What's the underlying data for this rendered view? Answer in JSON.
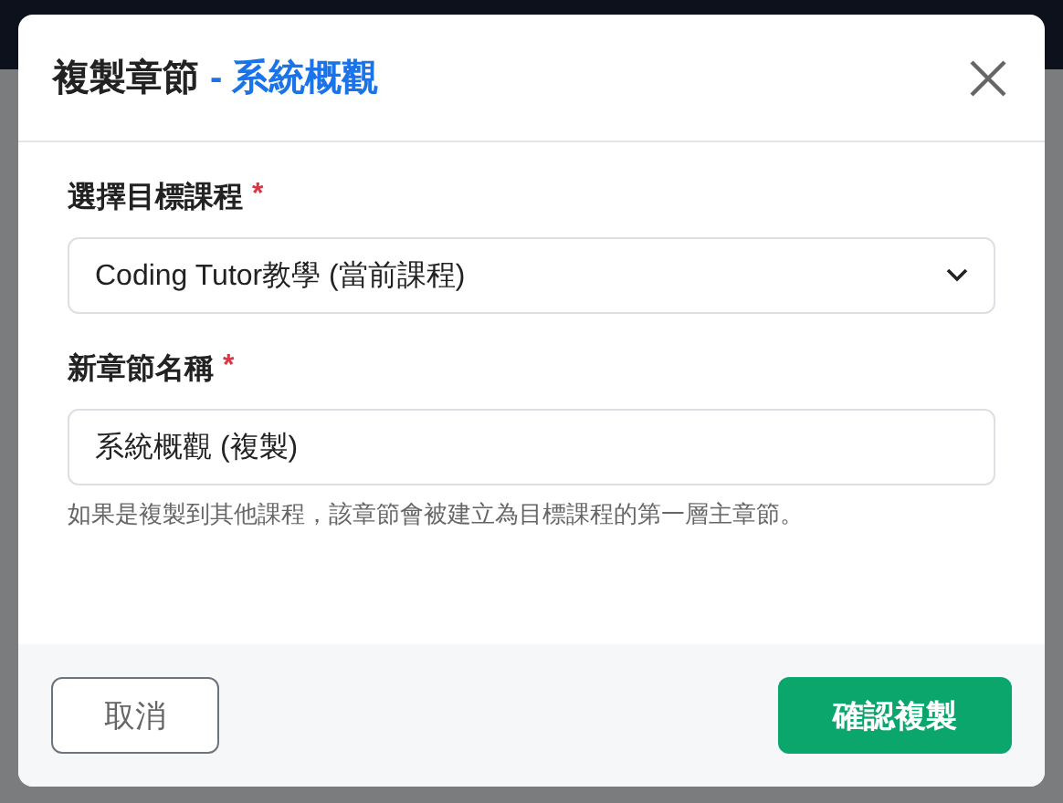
{
  "dialog": {
    "title": "複製章節",
    "title_separator": "-",
    "chapter_name": "系統概觀",
    "fields": [
      {
        "kind": "select",
        "label": "選擇目標課程",
        "required_mark": "*",
        "value": "Coding Tutor教學 (當前課程)"
      },
      {
        "kind": "text",
        "label": "新章節名稱",
        "required_mark": "*",
        "value": "系統概觀 (複製)",
        "help": "如果是複製到其他課程，該章節會被建立為目標課程的第一層主章節。"
      }
    ],
    "buttons": [
      {
        "kind": "secondary",
        "label": "取消"
      },
      {
        "kind": "primary",
        "label": "確認複製"
      }
    ]
  }
}
